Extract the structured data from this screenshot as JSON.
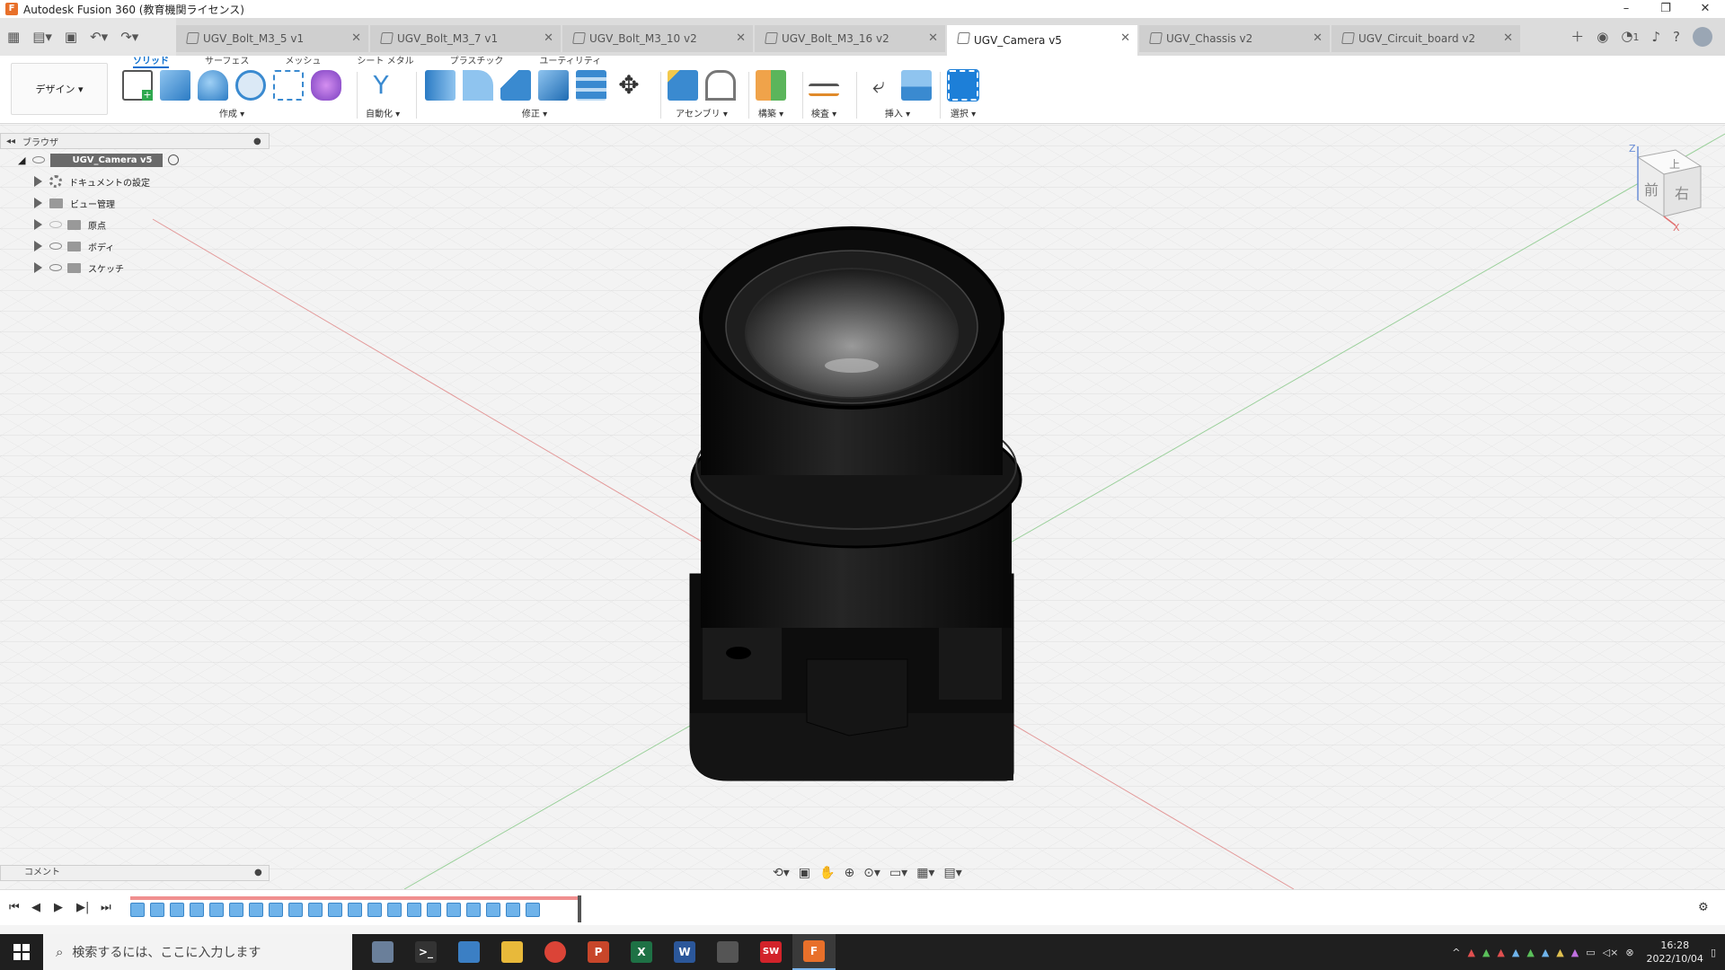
{
  "window": {
    "title": "Autodesk Fusion 360 (教育機関ライセンス)",
    "controls": [
      "–",
      "❐",
      "✕"
    ]
  },
  "doc_tabs": [
    {
      "label": "UGV_Bolt_M3_5 v1",
      "active": false
    },
    {
      "label": "UGV_Bolt_M3_7 v1",
      "active": false
    },
    {
      "label": "UGV_Bolt_M3_10 v2",
      "active": false
    },
    {
      "label": "UGV_Bolt_M3_16 v2",
      "active": false
    },
    {
      "label": "UGV_Camera v5",
      "active": true
    },
    {
      "label": "UGV_Chassis v2",
      "active": false
    },
    {
      "label": "UGV_Circuit_board v2",
      "active": false
    }
  ],
  "tab_close": "✕",
  "top_right": {
    "job_count": "1"
  },
  "ribbon": {
    "workspace": "デザイン ▾",
    "ws_tabs": [
      "ソリッド",
      "サーフェス",
      "メッシュ",
      "シート メタル",
      "プラスチック",
      "ユーティリティ"
    ],
    "groups": {
      "create": "作成 ▾",
      "automate": "自動化 ▾",
      "modify": "修正 ▾",
      "assemble": "アセンブリ ▾",
      "construct": "構築 ▾",
      "inspect": "検査 ▾",
      "insert": "挿入 ▾",
      "select": "選択 ▾"
    }
  },
  "browser": {
    "header": "ブラウザ",
    "root": "UGV_Camera v5",
    "items": [
      {
        "label": "ドキュメントの設定",
        "icon": "gear-icon"
      },
      {
        "label": "ビュー管理",
        "icon": "folder-icon"
      },
      {
        "label": "原点",
        "icon": "folder-icon"
      },
      {
        "label": "ボディ",
        "icon": "folder-icon"
      },
      {
        "label": "スケッチ",
        "icon": "folder-icon"
      }
    ]
  },
  "viewcube": {
    "top": "上",
    "front": "前",
    "right": "右",
    "z": "Z",
    "x": "X"
  },
  "comment": {
    "label": "コメント"
  },
  "taskbar": {
    "search_placeholder": "検索するには、ここに入力します",
    "time": "16:28",
    "date": "2022/10/04",
    "apps": [
      {
        "name": "photos-app-icon",
        "color": "#6a7f9a",
        "text": ""
      },
      {
        "name": "terminal-app-icon",
        "color": "#333333",
        "text": ">_"
      },
      {
        "name": "notes-app-icon",
        "color": "#3b7fc4",
        "text": ""
      },
      {
        "name": "file-explorer-icon",
        "color": "#e8b93a",
        "text": ""
      },
      {
        "name": "chrome-icon",
        "color": "#db4437",
        "text": ""
      },
      {
        "name": "powerpoint-icon",
        "color": "#c8462a",
        "text": "P"
      },
      {
        "name": "excel-icon",
        "color": "#1e7145",
        "text": "X"
      },
      {
        "name": "word-icon",
        "color": "#2b579a",
        "text": "W"
      },
      {
        "name": "game-app-icon",
        "color": "#555555",
        "text": ""
      },
      {
        "name": "solidworks-icon",
        "color": "#d2232a",
        "text": "SW"
      },
      {
        "name": "fusion360-icon",
        "color": "#e8702a",
        "text": "F"
      }
    ]
  }
}
